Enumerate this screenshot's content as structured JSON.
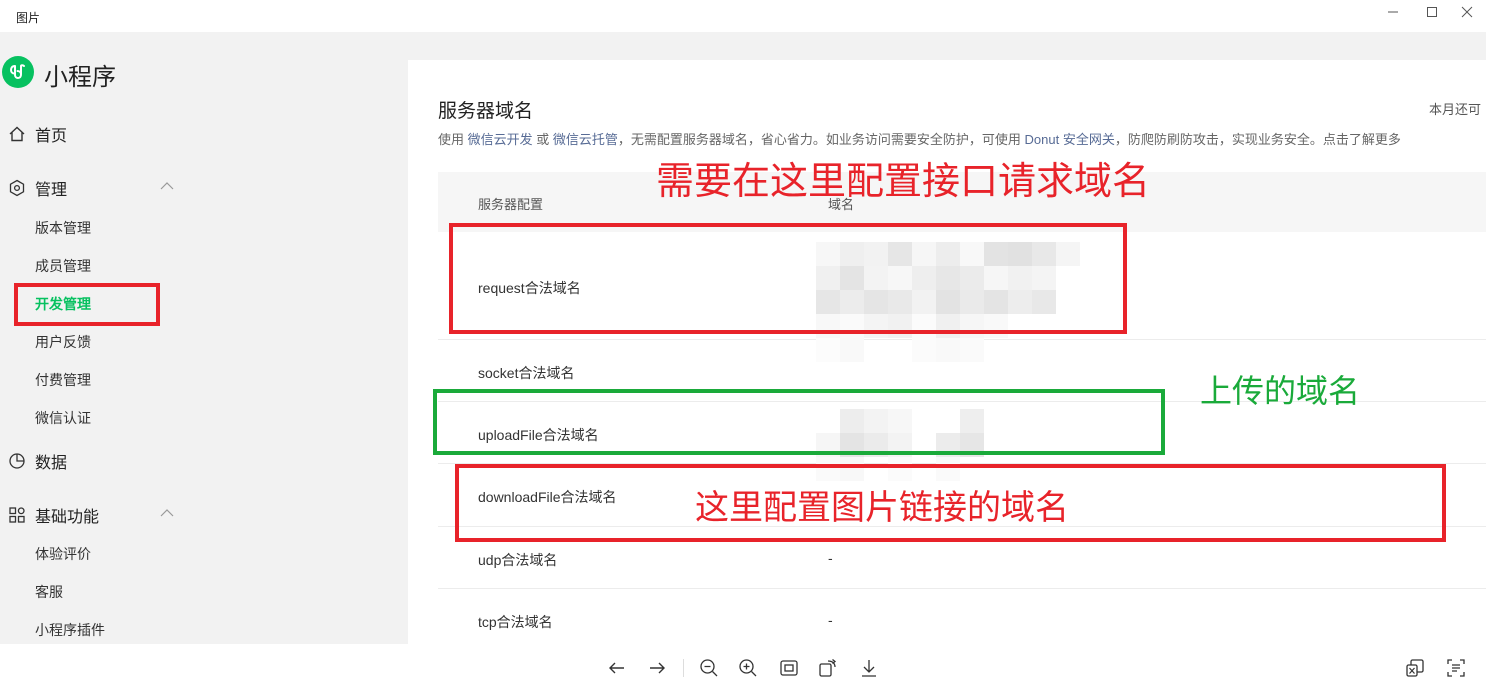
{
  "window": {
    "title": "图片"
  },
  "sidebar": {
    "brand": "小程序",
    "home": "首页",
    "manage": "管理",
    "manage_items": [
      "版本管理",
      "成员管理",
      "开发管理",
      "用户反馈",
      "付费管理",
      "微信认证"
    ],
    "data": "数据",
    "basic": "基础功能",
    "basic_items": [
      "体验评价",
      "客服",
      "小程序插件"
    ]
  },
  "panel": {
    "title": "服务器域名",
    "quota": "本月还可",
    "desc": {
      "p1": "使用 ",
      "link1": "微信云开发",
      "p2": " 或 ",
      "link2": "微信云托管",
      "p3": "，无需配置服务器域名，省心省力。如业务访问需要安全防护，可使用 ",
      "link3": "Donut 安全网关",
      "p4": "，防爬防刷防攻击，实现业务安全。点击了解更多"
    },
    "columns": [
      "服务器配置",
      "域名"
    ],
    "rows": [
      {
        "name": "request合法域名",
        "value": ""
      },
      {
        "name": "socket合法域名",
        "value": ""
      },
      {
        "name": "uploadFile合法域名",
        "value": ""
      },
      {
        "name": "downloadFile合法域名",
        "value": ""
      },
      {
        "name": "udp合法域名",
        "value": "-"
      },
      {
        "name": "tcp合法域名",
        "value": "-"
      }
    ]
  },
  "annotations": {
    "request": "需要在这里配置接口请求域名",
    "upload": "上传的域名",
    "download": "这里配置图片链接的域名"
  },
  "colors": {
    "annotation_red": "#e8232a",
    "annotation_green": "#1aaa3a",
    "brand_green": "#07c160",
    "link": "#576b95"
  },
  "toolbar": {
    "icons": [
      "arrow-left-icon",
      "arrow-right-icon",
      "zoom-out-icon",
      "zoom-in-icon",
      "fit-window-icon",
      "rotate-icon",
      "download-icon",
      "copy-image-icon",
      "ocr-icon"
    ]
  }
}
